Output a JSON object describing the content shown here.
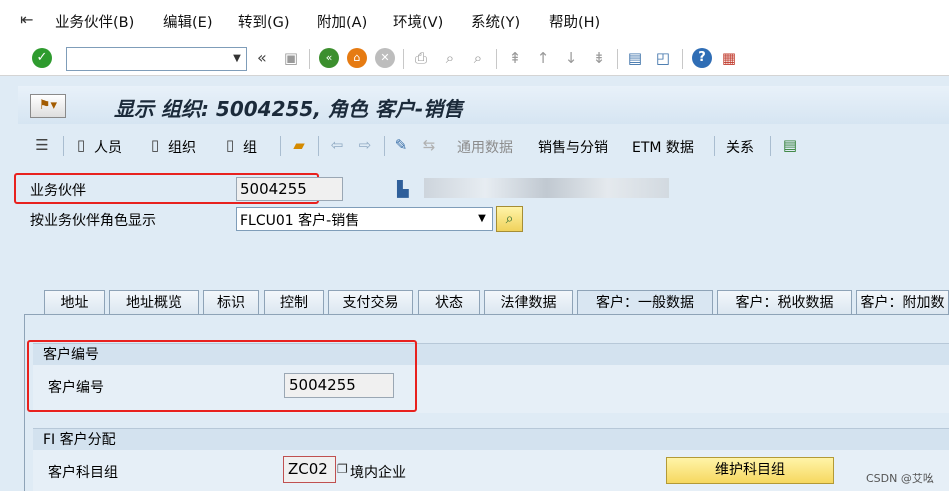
{
  "menu": {
    "items": [
      "业务伙伴(B)",
      "编辑(E)",
      "转到(G)",
      "附加(A)",
      "环境(V)",
      "系统(Y)",
      "帮助(H)"
    ]
  },
  "toolbar": {
    "command_value": "",
    "back_symbol": "«"
  },
  "title": {
    "text": "显示 组织: 5004255, 角色 客户-销售"
  },
  "app_toolbar": {
    "person": "人员",
    "organization": "组织",
    "group": "组",
    "general_data": "通用数据",
    "sales_distribution": "销售与分销",
    "etm_data": "ETM 数据",
    "relations": "关系"
  },
  "header": {
    "partner_label": "业务伙伴",
    "partner_value": "5004255",
    "role_label": "按业务伙伴角色显示",
    "role_value": "FLCU01 客户-销售"
  },
  "tabs": [
    {
      "label": "地址",
      "active": false
    },
    {
      "label": "地址概览",
      "active": false
    },
    {
      "label": "标识",
      "active": false
    },
    {
      "label": "控制",
      "active": false
    },
    {
      "label": "支付交易",
      "active": false
    },
    {
      "label": "状态",
      "active": false
    },
    {
      "label": "法律数据",
      "active": false
    },
    {
      "label": "客户：一般数据",
      "active": true
    },
    {
      "label": "客户：税收数据",
      "active": false
    },
    {
      "label": "客户：附加数",
      "active": false
    }
  ],
  "customer_number_group": {
    "title": "客户编号",
    "field_label": "客户编号",
    "field_value": "5004255"
  },
  "fi_group": {
    "title": "FI 客户分配",
    "field_label": "客户科目组",
    "field_value": "ZC02",
    "field_description": "境内企业",
    "button_label": "维护科目组"
  },
  "watermark": "CSDN @艾吆",
  "colors": {
    "highlight_red": "#e8211e",
    "panel_blue": "#dfebf5",
    "button_yellow": "#f6d860",
    "ok_green": "#2e9b2e"
  }
}
